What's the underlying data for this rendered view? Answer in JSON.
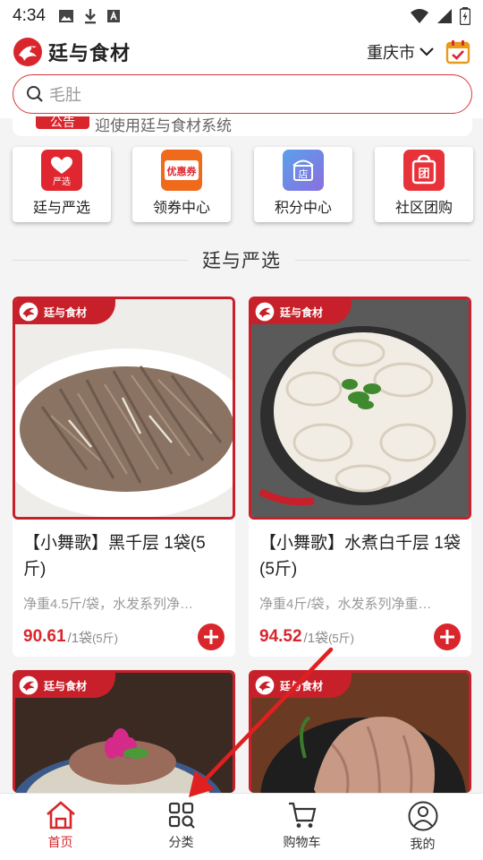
{
  "status": {
    "time": "4:34"
  },
  "header": {
    "title": "廷与食材",
    "city": "重庆市"
  },
  "search": {
    "placeholder": "毛肚"
  },
  "notice": {
    "tag": "公告",
    "text": "迎使用廷与食材系统"
  },
  "quick_menu": [
    {
      "label": "廷与严选",
      "icon": "heart-select-icon",
      "icon_text": "严选",
      "color": "#e0262f"
    },
    {
      "label": "领券中心",
      "icon": "coupon-icon",
      "icon_text": "优惠券",
      "color": "#f06a1c"
    },
    {
      "label": "积分中心",
      "icon": "points-store-icon",
      "icon_text": "店",
      "color": "#4a8fe0"
    },
    {
      "label": "社区团购",
      "icon": "group-buy-icon",
      "icon_text": "团",
      "color": "#e8323a"
    }
  ],
  "section": {
    "title": "廷与严选"
  },
  "badge_text": "廷与食材",
  "products": [
    {
      "name": "【小舞歌】黑千层 1袋(5斤)",
      "desc": "净重4.5斤/袋，水发系列净…",
      "price": "90.61",
      "unit": "/1袋",
      "unit_note": "(5斤)"
    },
    {
      "name": "【小舞歌】水煮白千层 1袋(5斤)",
      "desc": "净重4斤/袋，水发系列净重…",
      "price": "94.52",
      "unit": "/1袋",
      "unit_note": "(5斤)"
    },
    {
      "name": "",
      "desc": "",
      "price": "",
      "unit": "",
      "unit_note": ""
    },
    {
      "name": "",
      "desc": "",
      "price": "",
      "unit": "",
      "unit_note": ""
    }
  ],
  "tabbar": [
    {
      "label": "首页",
      "icon": "home-icon",
      "active": true
    },
    {
      "label": "分类",
      "icon": "category-grid-icon",
      "active": false
    },
    {
      "label": "购物车",
      "icon": "cart-icon",
      "active": false
    },
    {
      "label": "我的",
      "icon": "profile-icon",
      "active": false
    }
  ],
  "colors": {
    "brand_red": "#d9262c",
    "tab_active": "#d9262c",
    "annotation_arrow": "#e02020"
  }
}
